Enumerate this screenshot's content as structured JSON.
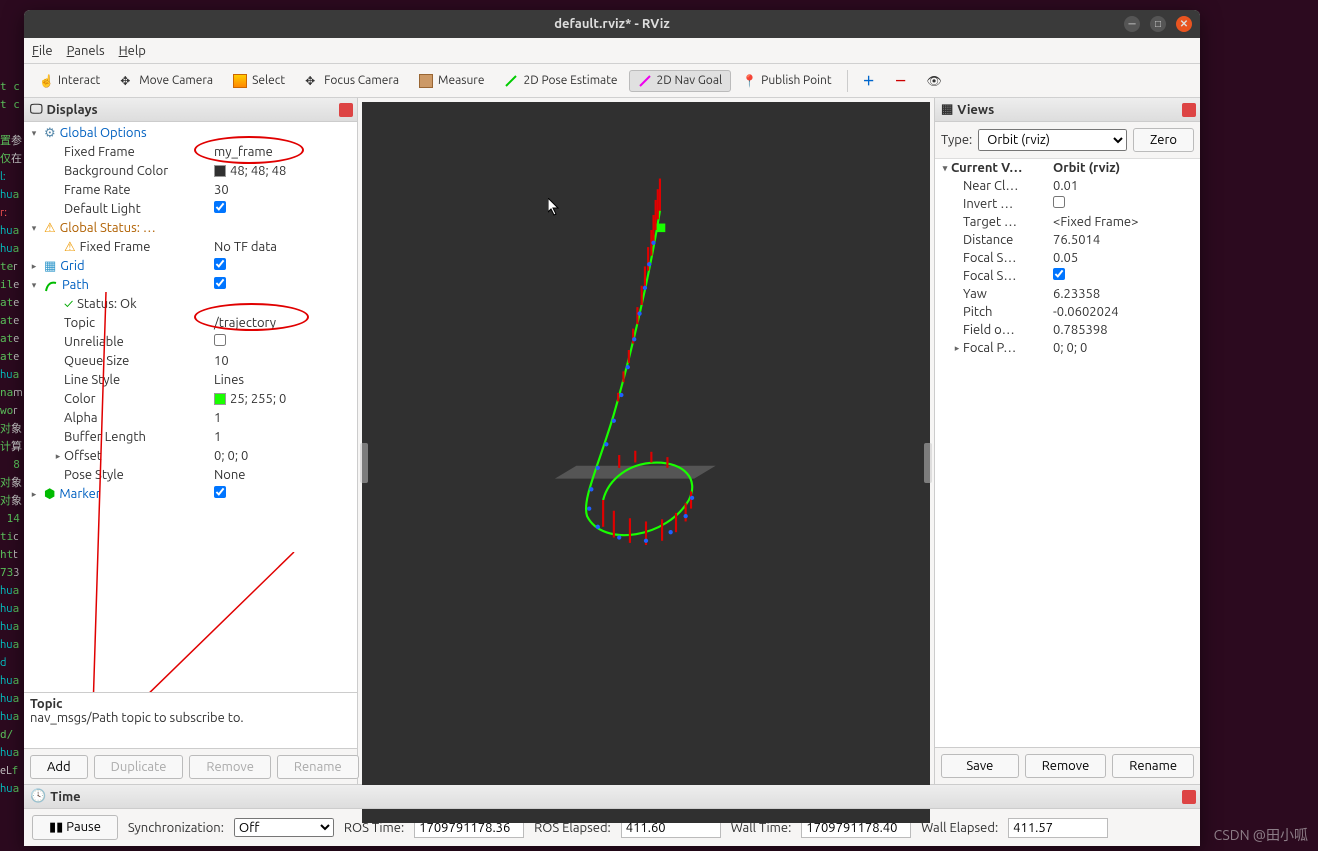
{
  "window": {
    "title": "default.rviz* - RViz"
  },
  "menus": {
    "file": "File",
    "panels": "Panels",
    "help": "Help"
  },
  "toolbar": {
    "interact": "Interact",
    "move_camera": "Move Camera",
    "select": "Select",
    "focus_camera": "Focus Camera",
    "measure": "Measure",
    "pose_estimate": "2D Pose Estimate",
    "nav_goal": "2D Nav Goal",
    "publish_point": "Publish Point"
  },
  "displays": {
    "title": "Displays",
    "global_options": {
      "label": "Global Options",
      "fixed_frame": {
        "label": "Fixed Frame",
        "value": "my_frame"
      },
      "bg_color": {
        "label": "Background Color",
        "value": "48; 48; 48",
        "hex": "#303030"
      },
      "frame_rate": {
        "label": "Frame Rate",
        "value": "30"
      },
      "default_light": {
        "label": "Default Light",
        "checked": true
      }
    },
    "global_status": {
      "label": "Global Status: …",
      "fixed_frame": {
        "label": "Fixed Frame",
        "value": "No TF data"
      }
    },
    "grid": {
      "label": "Grid",
      "checked": true
    },
    "path": {
      "label": "Path",
      "checked": true,
      "status": "Status: Ok",
      "topic": {
        "label": "Topic",
        "value": "/trajectory"
      },
      "unreliable": {
        "label": "Unreliable",
        "checked": false
      },
      "queue_size": {
        "label": "Queue Size",
        "value": "10"
      },
      "line_style": {
        "label": "Line Style",
        "value": "Lines"
      },
      "color": {
        "label": "Color",
        "value": "25; 255; 0",
        "hex": "#19ff00"
      },
      "alpha": {
        "label": "Alpha",
        "value": "1"
      },
      "buffer_length": {
        "label": "Buffer Length",
        "value": "1"
      },
      "offset": {
        "label": "Offset",
        "value": "0; 0; 0"
      },
      "pose_style": {
        "label": "Pose Style",
        "value": "None"
      }
    },
    "marker": {
      "label": "Marker",
      "checked": true
    },
    "desc": {
      "title": "Topic",
      "text": "nav_msgs/Path topic to subscribe to."
    },
    "buttons": {
      "add": "Add",
      "duplicate": "Duplicate",
      "remove": "Remove",
      "rename": "Rename"
    }
  },
  "views": {
    "title": "Views",
    "type_label": "Type:",
    "type_value": "Orbit (rviz)",
    "zero": "Zero",
    "current": {
      "label": "Current V…",
      "value": "Orbit (rviz)"
    },
    "props": {
      "near_clip": {
        "label": "Near Cl…",
        "value": "0.01"
      },
      "invert_z": {
        "label": "Invert …",
        "checked": false
      },
      "target_frame": {
        "label": "Target …",
        "value": "<Fixed Frame>"
      },
      "distance": {
        "label": "Distance",
        "value": "76.5014"
      },
      "focal_shape_size": {
        "label": "Focal S…",
        "value": "0.05"
      },
      "focal_shape_fixed": {
        "label": "Focal S…",
        "checked": true
      },
      "yaw": {
        "label": "Yaw",
        "value": "6.23358"
      },
      "pitch": {
        "label": "Pitch",
        "value": "-0.0602024"
      },
      "fov": {
        "label": "Field o…",
        "value": "0.785398"
      },
      "focal_point": {
        "label": "Focal P…",
        "value": "0; 0; 0"
      }
    },
    "buttons": {
      "save": "Save",
      "remove": "Remove",
      "rename": "Rename"
    }
  },
  "time": {
    "title": "Time",
    "pause": "Pause",
    "sync_label": "Synchronization:",
    "sync_value": "Off",
    "ros_time_label": "ROS Time:",
    "ros_time": "1709791178.36",
    "ros_elapsed_label": "ROS Elapsed:",
    "ros_elapsed": "411.60",
    "wall_time_label": "Wall Time:",
    "wall_time": "1709791178.40",
    "wall_elapsed_label": "Wall Elapsed:",
    "wall_elapsed": "411.57"
  },
  "watermark": "CSDN @田小呱"
}
